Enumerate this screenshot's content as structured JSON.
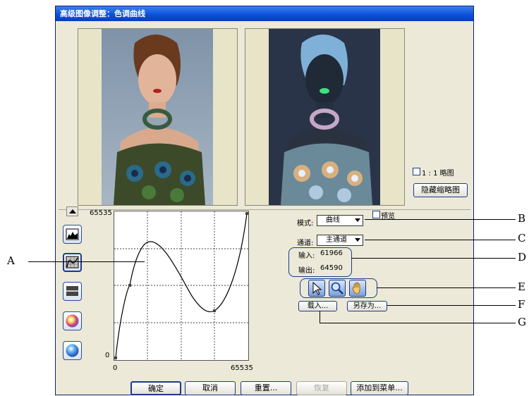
{
  "window": {
    "title": "高级图像调整：色调曲线"
  },
  "thumbnails": {
    "actual_size_label": "1 : 1 略图",
    "actual_size_checked": false,
    "hide_button": "隐藏缩略图"
  },
  "curve": {
    "y_max_label": "65535",
    "y_min_label": "0",
    "x_min_label": "0",
    "x_max_label": "65535"
  },
  "controls": {
    "preview_label": "预览",
    "preview_checked": false,
    "mode_label": "模式:",
    "mode_value": "曲线",
    "channel_label": "通道:",
    "channel_value": "主通道",
    "input_label": "输入:",
    "input_value": "61966",
    "output_label": "输出:",
    "output_value": "64590",
    "load_button": "载入...",
    "save_as_button": "另存为..."
  },
  "bottom_buttons": {
    "ok": "确定",
    "cancel": "取消",
    "reset": "重置...",
    "restore": "恢复",
    "add_to_menu": "添加到菜单..."
  },
  "annotations": {
    "a": "A",
    "b": "B",
    "c": "C",
    "d": "D",
    "e": "E",
    "f": "F",
    "g": "G"
  },
  "side_icons": [
    "histogram-icon",
    "curve-icon",
    "levels-icon",
    "color-wheel-icon",
    "sphere-icon"
  ],
  "tool_icons": [
    "arrow-icon",
    "magnifier-icon",
    "hand-icon"
  ]
}
